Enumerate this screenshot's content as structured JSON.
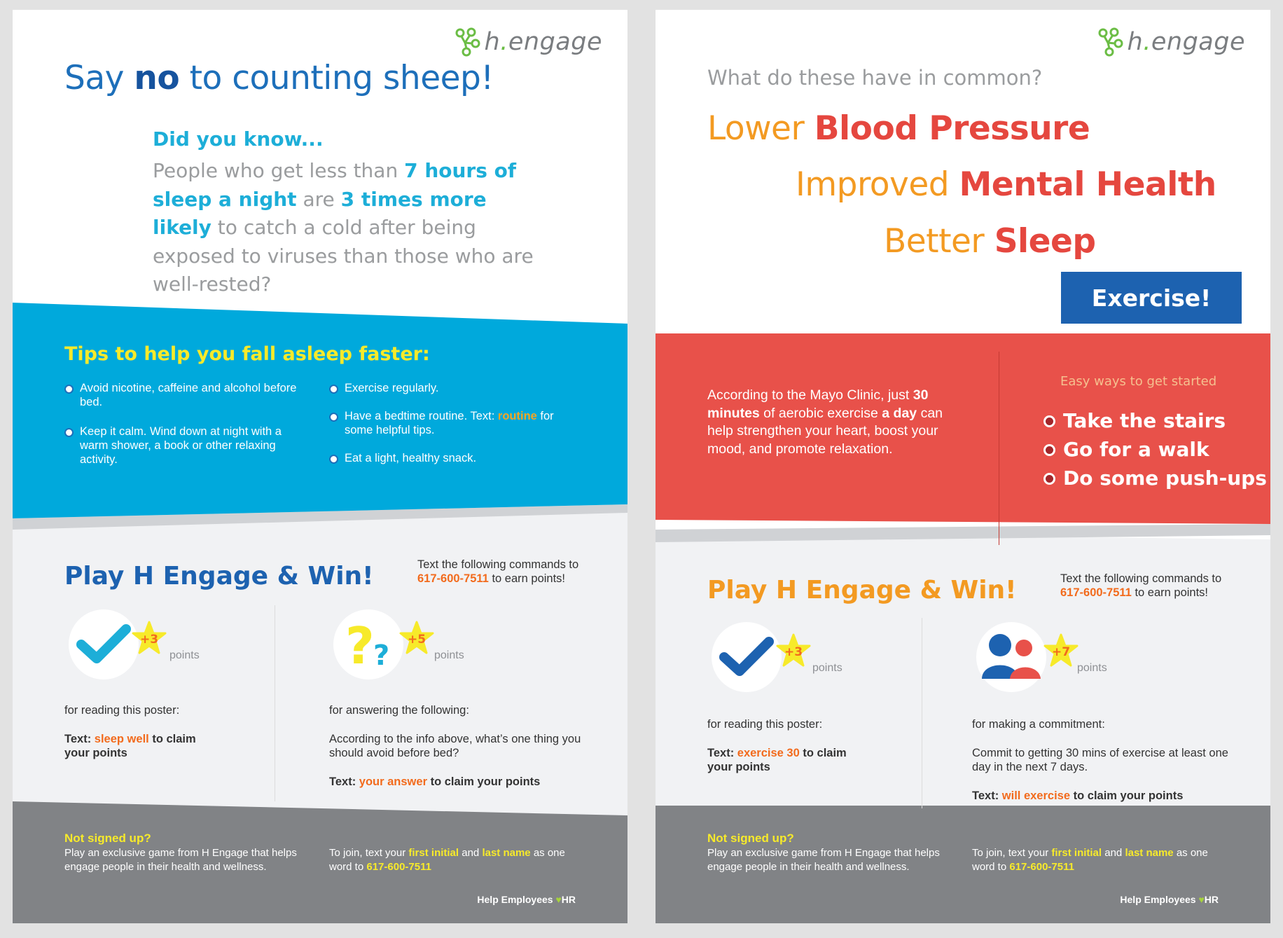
{
  "brand": {
    "logo_name": "h.engage",
    "logo_h": "h",
    "logo_dot": ".",
    "logo_rest": "engage",
    "green": "#6bbd45",
    "blue": "#1d6fba",
    "cyan": "#00a9dc",
    "orange": "#f39a22",
    "red": "#e8514a",
    "yellow": "#f7ea2a"
  },
  "left": {
    "headline": {
      "pre": "Say ",
      "bold": "no",
      "post": " to counting sheep!"
    },
    "did_you_know": "Did you know...",
    "fact": {
      "p1": "People who get less than ",
      "b1": "7 hours of sleep a night",
      "p2": " are ",
      "b2": "3 times more likely",
      "p3": " to catch a cold after being exposed to viruses than those who are well-rested?"
    },
    "tips_title": "Tips to help you fall asleep faster:",
    "tips_col1": [
      "Avoid nicotine, caffeine and alcohol before bed.",
      "Keep it calm. Wind down at night with a warm shower, a book or other relaxing activity."
    ],
    "tips_col2": {
      "t1": "Exercise regularly.",
      "t2_pre": "Have a bedtime routine. Text: ",
      "t2_kw": "routine",
      "t2_post": " for some helpful tips.",
      "t3": "Eat a light, healthy snack."
    },
    "play_title": "Play H Engage & Win!",
    "text_cmd_pre": "Text the following commands to",
    "phone": "617-600-7511",
    "text_cmd_post": " to earn points!",
    "badge1": {
      "icon": "checkmark-icon",
      "points": "+3",
      "points_label": "points",
      "for": "for reading this poster:",
      "text_label": "Text: ",
      "keyword": "sleep well",
      "claim": " to claim your points"
    },
    "badge2": {
      "icon": "question-marks-icon",
      "points": "+5",
      "points_label": "points",
      "for": "for answering the following:",
      "question": "According to the info above, what’s one thing you should avoid before bed?",
      "text_label": "Text: ",
      "keyword": "your answer",
      "claim": " to claim your points"
    },
    "footer": {
      "title": "Not signed up?",
      "desc": "Play an exclusive game from H Engage that helps engage people in their health and wellness.",
      "join_pre": "To join, text your ",
      "join_kw1": "first initial",
      "join_and": " and ",
      "join_kw2": "last name",
      "join_post": " as one word to ",
      "phone": "617-600-7511",
      "sig_pre": "Help Employees ",
      "sig_heart": "♥",
      "sig_post": "HR"
    }
  },
  "right": {
    "question": "What do these have in common?",
    "benefits": [
      {
        "pre": "Lower ",
        "bold": "Blood Pressure"
      },
      {
        "pre": "Improved ",
        "bold": "Mental Health"
      },
      {
        "pre": "Better ",
        "bold": "Sleep"
      }
    ],
    "cta": "Exercise!",
    "mayo": {
      "p1": "According to the Mayo Clinic, just ",
      "b1": "30 minutes",
      "p2": " of aerobic exercise ",
      "b2": "a day",
      "p3": " can help strengthen your heart, boost your mood, and promote relaxation."
    },
    "easy_title": "Easy ways to get started",
    "steps": [
      "Take the stairs",
      "Go for a walk",
      "Do some push-ups"
    ],
    "play_title": "Play H Engage & Win!",
    "text_cmd_pre": "Text the following commands to",
    "phone": "617-600-7511",
    "text_cmd_post": " to earn points!",
    "badge1": {
      "icon": "checkmark-icon",
      "points": "+3",
      "points_label": "points",
      "for": "for reading this poster:",
      "text_label": "Text: ",
      "keyword": "exercise 30",
      "claim": " to claim your points"
    },
    "badge2": {
      "icon": "people-icon",
      "points": "+7",
      "points_label": "points",
      "for": "for making a commitment:",
      "question": "Commit to getting 30 mins of exercise at least one day in the next 7 days.",
      "text_label": "Text: ",
      "keyword": "will exercise",
      "claim": " to claim your points"
    },
    "footer": {
      "title": "Not signed up?",
      "desc": "Play an exclusive game from H Engage that helps engage people in their health and wellness.",
      "join_pre": "To join, text your ",
      "join_kw1": "first initial",
      "join_and": " and ",
      "join_kw2": "last name",
      "join_post": " as one word to ",
      "phone": "617-600-7511",
      "sig_pre": "Help Employees ",
      "sig_heart": "♥",
      "sig_post": "HR"
    }
  }
}
